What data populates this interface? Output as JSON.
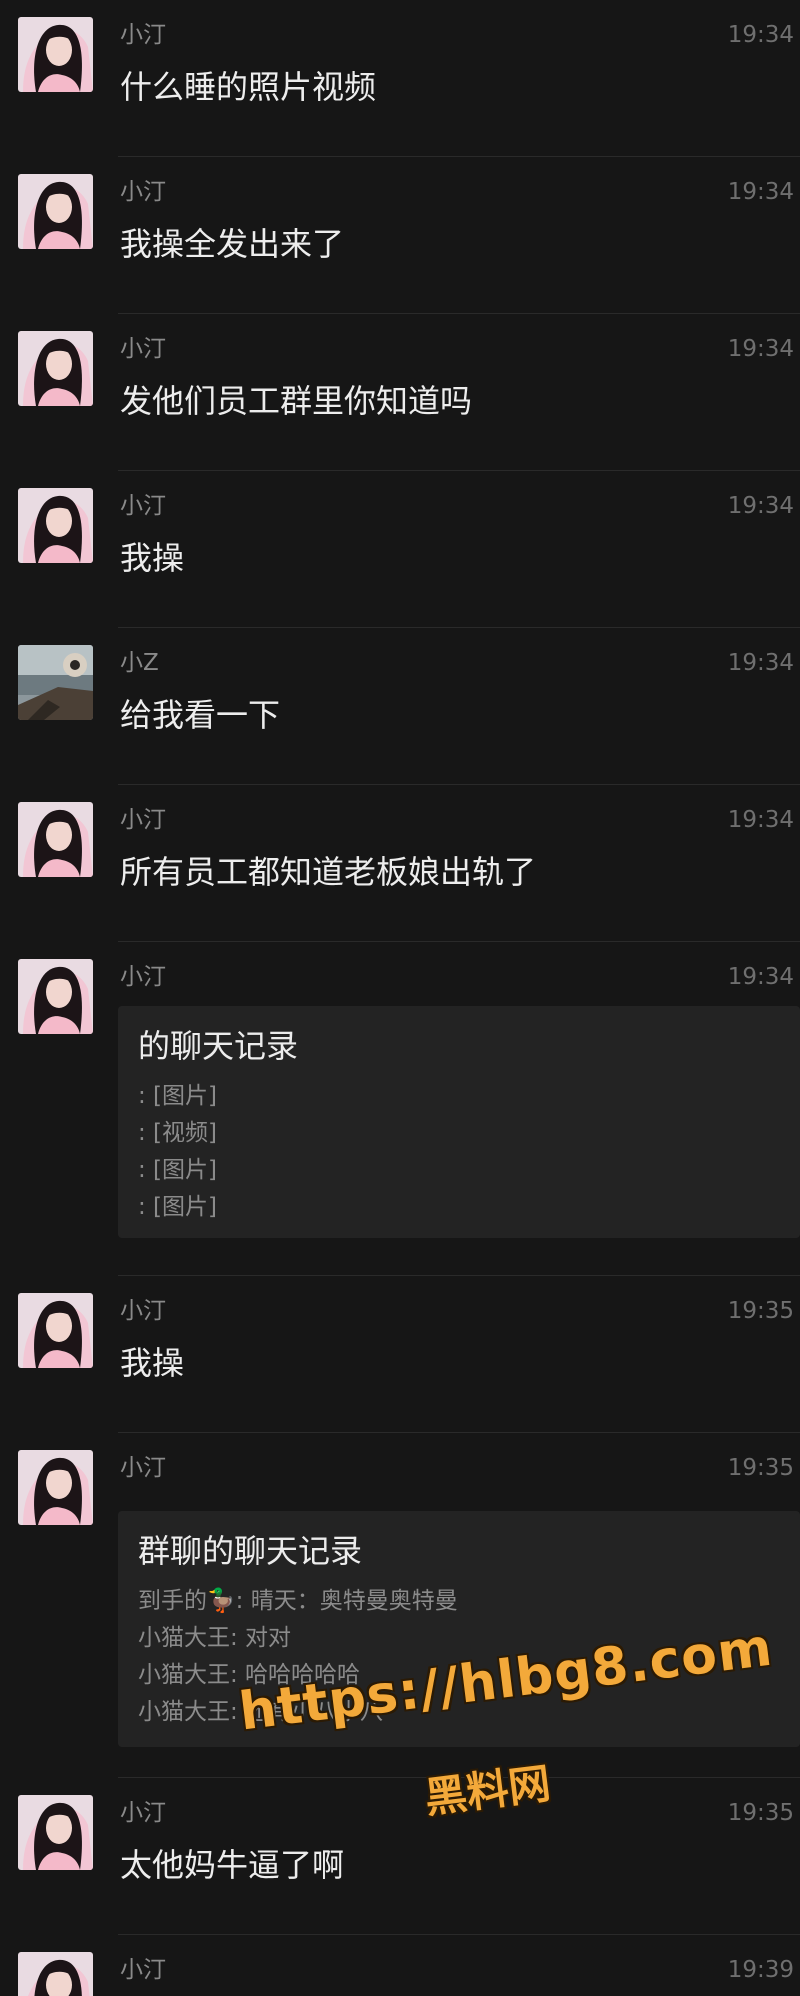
{
  "messages": [
    {
      "sender": "小汀",
      "time": "19:34",
      "text": "什么睡的照片视频",
      "avatar": "girl-avatar"
    },
    {
      "sender": "小汀",
      "time": "19:34",
      "text": "我操全发出来了",
      "avatar": "girl-avatar"
    },
    {
      "sender": "小汀",
      "time": "19:34",
      "text": "发他们员工群里你知道吗",
      "avatar": "girl-avatar"
    },
    {
      "sender": "小汀",
      "time": "19:34",
      "text": "我操",
      "avatar": "girl-avatar"
    },
    {
      "sender": "小Z",
      "time": "19:34",
      "text": "给我看一下",
      "avatar": "window-avatar"
    },
    {
      "sender": "小汀",
      "time": "19:34",
      "text": "所有员工都知道老板娘出轨了",
      "avatar": "girl-avatar"
    },
    {
      "sender": "小汀",
      "time": "19:34",
      "avatar": "girl-avatar",
      "card": {
        "title": "的聊天记录",
        "lines": [
          ": [图片]",
          ": [视频]",
          ": [图片]",
          ": [图片]"
        ]
      }
    },
    {
      "sender": "小汀",
      "time": "19:35",
      "text": "我操",
      "avatar": "girl-avatar"
    },
    {
      "sender": "小汀",
      "time": "19:35",
      "avatar": "girl-avatar",
      "card": {
        "title": "群聊的聊天记录",
        "lines": [
          "到手的🦆: 晴天：奥特曼奥特曼",
          "小猫大王: 对对",
          "小猫大王: 哈哈哈哈哈",
          "小猫大王: 还有小八小八"
        ]
      }
    },
    {
      "sender": "小汀",
      "time": "19:35",
      "text": "太他妈牛逼了啊",
      "avatar": "girl-avatar"
    },
    {
      "sender": "小汀",
      "time": "19:39",
      "text": "",
      "avatar": "girl-avatar"
    }
  ],
  "watermark": {
    "url": "https://hlbg8.com",
    "label": "黑料网"
  },
  "colors": {
    "background": "#161616",
    "text": "#ededed",
    "meta": "#8a8a8a",
    "card": "#232323",
    "watermark": "#f3a93a"
  }
}
